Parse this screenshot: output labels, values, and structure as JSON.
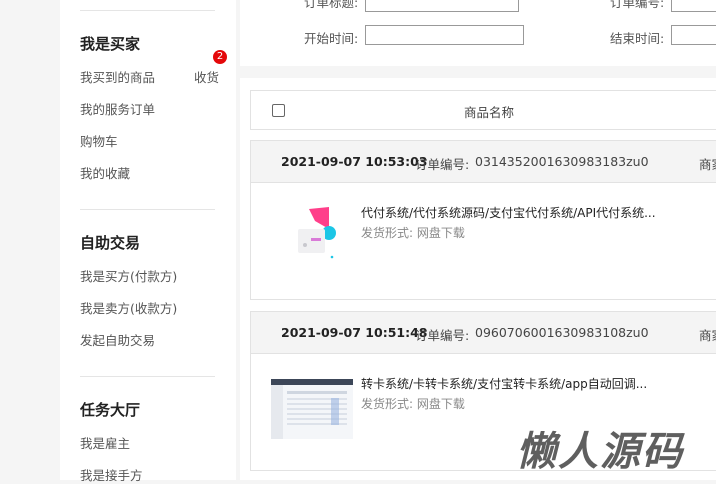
{
  "sidebar": {
    "buyer": {
      "title": "我是买家",
      "items": [
        {
          "label": "我买到的商品",
          "right": "收货",
          "badge": "2"
        },
        {
          "label": "我的服务订单"
        },
        {
          "label": "购物车"
        },
        {
          "label": "我的收藏"
        }
      ]
    },
    "trade": {
      "title": "自助交易",
      "items": [
        {
          "label": "我是买方(付款方)"
        },
        {
          "label": "我是卖方(收款方)"
        },
        {
          "label": "发起自助交易"
        }
      ]
    },
    "tasks": {
      "title": "任务大厅",
      "items": [
        {
          "label": "我是雇主"
        },
        {
          "label": "我是接手方"
        }
      ]
    }
  },
  "filters": {
    "order_title_label": "订单标题:",
    "order_no_label": "订单编号:",
    "start_time_label": "开始时间:",
    "end_time_label": "结束时间:"
  },
  "table": {
    "product_name_header": "商品名称"
  },
  "orders": [
    {
      "time": "2021-09-07 10:53:03",
      "order_no_label": "订单编号:",
      "order_no": "031435200163098318320",
      "order_no_display": "0314352001630983183zu0",
      "shop_label": "商家",
      "title": "代付系统/代付系统源码/支付宝代付系统/API代付系统...",
      "shipping": "发货形式: 网盘下载"
    },
    {
      "time": "2021-09-07 10:51:48",
      "order_no_label": "订单编号:",
      "order_no_display": "0960706001630983108zu0",
      "shop_label": "商家",
      "title": "转卡系统/卡转卡系统/支付宝转卡系统/app自动回调...",
      "shipping": "发货形式: 网盘下载"
    }
  ],
  "watermark": "懒人源码",
  "colors": {
    "badge": "#e4080a",
    "panel": "#ffffff",
    "background": "#f5f5f5"
  }
}
